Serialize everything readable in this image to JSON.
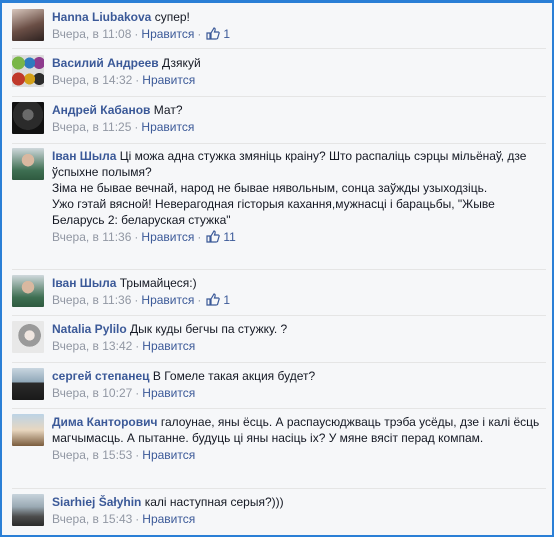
{
  "comments": [
    {
      "name": "Hanna Liubakova",
      "text": "супер!",
      "time": "Вчера, в 11:08",
      "like": "Нравится",
      "likes": "1"
    },
    {
      "name": "Василий Андреев",
      "text": "Дзякуй",
      "time": "Вчера, в 14:32",
      "like": "Нравится",
      "likes": ""
    },
    {
      "name": "Андрей Кабанов",
      "text": "Мат?",
      "time": "Вчера, в 11:25",
      "like": "Нравится",
      "likes": ""
    },
    {
      "name": "Іван Шыла",
      "text": "Ці можа адна стужка змяніць краіну? Што распаліць сэрцы мільёнаў, дзе ўспыхне полымя?",
      "text2": "Зіма не бывае вечнай, народ не бывае нявольным, сонца заўжды узыходзіць.",
      "text3": "Ужо гэтай вясной! Неверагодная гісторыя кахання,мужнасці і барацьбы, \"Жыве Беларусь 2: беларуская стужка\"",
      "time": "Вчера, в 11:36",
      "like": "Нравится",
      "likes": "11"
    },
    {
      "name": "Іван Шыла",
      "text": "Трымайцеся:)",
      "time": "Вчера, в 11:36",
      "like": "Нравится",
      "likes": "1"
    },
    {
      "name": "Natalia Pylilo",
      "text": "Дык куды бегчы па стужку. ?",
      "time": "Вчера, в 13:42",
      "like": "Нравится",
      "likes": ""
    },
    {
      "name": "сергей степанец",
      "text": "В Гомеле такая акция будет?",
      "time": "Вчера, в 10:27",
      "like": "Нравится",
      "likes": ""
    },
    {
      "name": "Дима Канторович",
      "text": "галоунае, яны ёсць. А распаусюджваць трэба усёды, дзе і калі ёсць магчымасць. А пытанне. будуць ці яны насіць іх? У мяне вясіт перад компам.",
      "time": "Вчера, в 15:53",
      "like": "Нравится",
      "likes": ""
    },
    {
      "name": "Siarhiej Šałyhin",
      "text": "калі наступная серыя?)))",
      "time": "Вчера, в 15:43",
      "like": "Нравится",
      "likes": ""
    }
  ]
}
